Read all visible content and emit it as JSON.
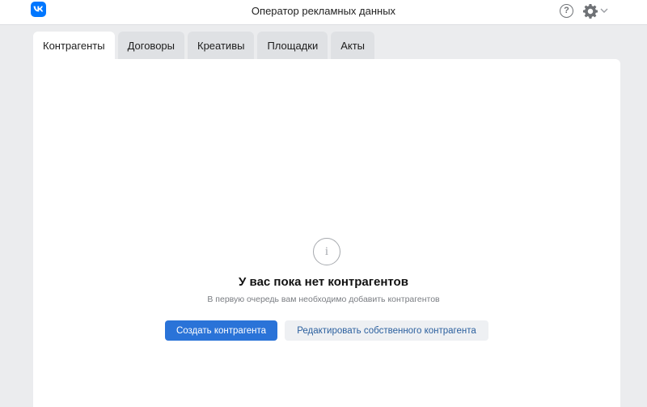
{
  "header": {
    "title": "Оператор рекламных данных",
    "logo_text": "VK",
    "help_icon": "help-icon",
    "settings_icon": "gear-icon",
    "menu_chevron_icon": "chevron-down-icon"
  },
  "tabs": [
    {
      "label": "Контрагенты",
      "active": true
    },
    {
      "label": "Договоры",
      "active": false
    },
    {
      "label": "Креативы",
      "active": false
    },
    {
      "label": "Площадки",
      "active": false
    },
    {
      "label": "Акты",
      "active": false
    }
  ],
  "empty_state": {
    "icon": "info-icon",
    "title": "У вас пока нет контрагентов",
    "subtitle": "В первую очередь вам необходимо добавить контрагентов",
    "primary_button": "Создать контрагента",
    "secondary_button": "Редактировать собственного контрагента"
  },
  "colors": {
    "brand": "#0077ff",
    "primary_button": "#2a73d8",
    "secondary_button_text": "#2a5f9e",
    "background": "#ebecee"
  }
}
